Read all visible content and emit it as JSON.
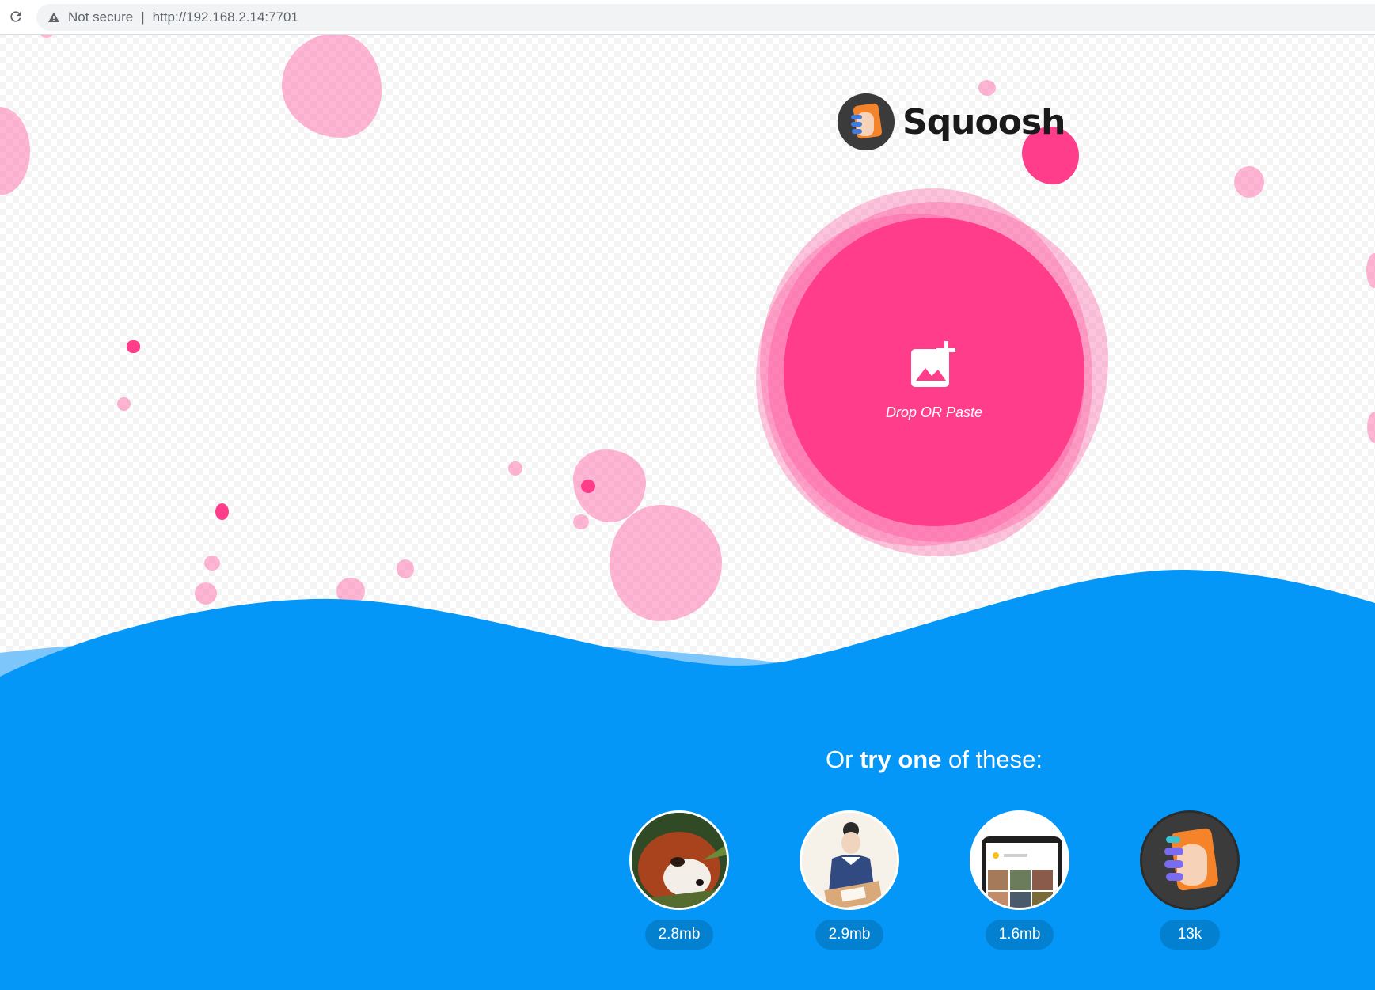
{
  "browser": {
    "security_label": "Not secure",
    "separator": "|",
    "url": "http://192.168.2.14:7701"
  },
  "app": {
    "name": "Squoosh",
    "colors": {
      "pink": "#ff3d8b",
      "water": "#0497f8",
      "water_light": "#7cc6fb",
      "pill": "#0480d0"
    }
  },
  "dropzone": {
    "label": "Drop OR Paste",
    "icon": "add-photo-icon"
  },
  "samples": {
    "heading_prefix": "Or ",
    "heading_bold": "try one",
    "heading_suffix": " of these:",
    "items": [
      {
        "name": "red-panda",
        "size": "2.8mb"
      },
      {
        "name": "artist-illustration",
        "size": "2.9mb"
      },
      {
        "name": "phone-screenshot",
        "size": "1.6mb"
      },
      {
        "name": "squoosh-logo",
        "size": "13k"
      }
    ]
  }
}
